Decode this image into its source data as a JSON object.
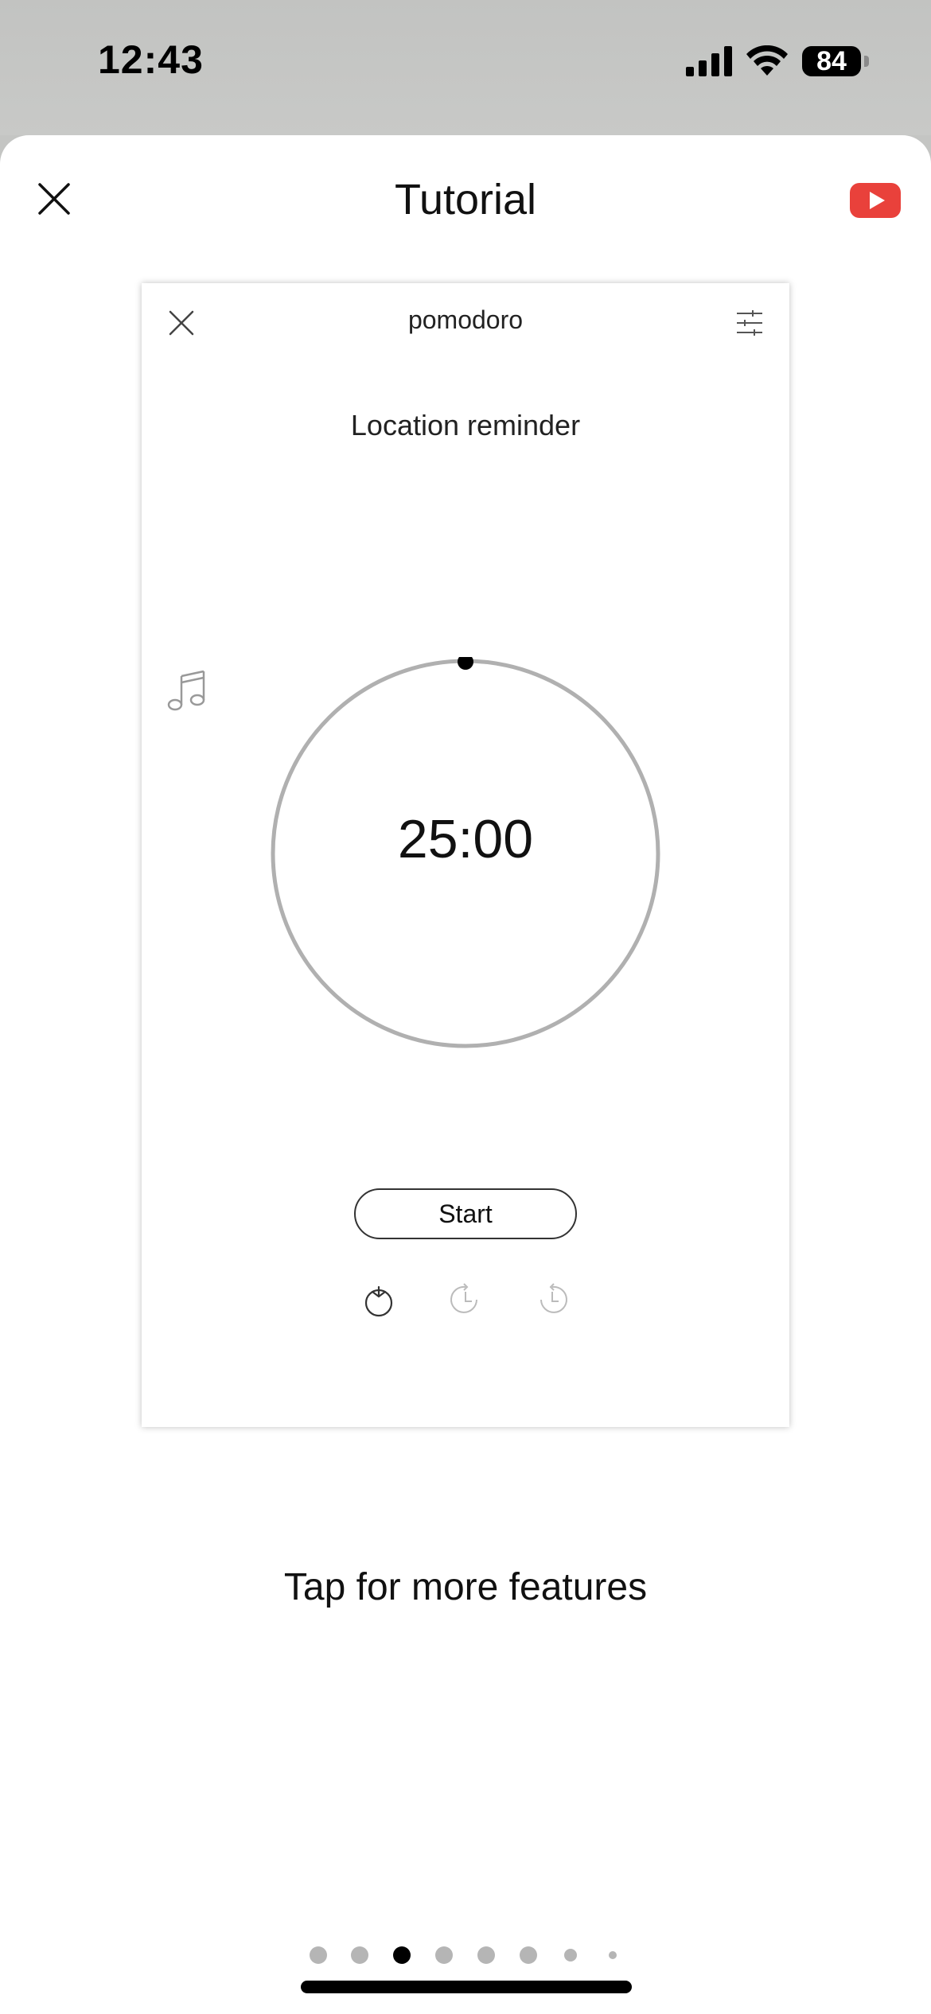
{
  "status_bar": {
    "time": "12:43",
    "battery": "84"
  },
  "sheet": {
    "title": "Tutorial",
    "close_icon": "close-icon",
    "video_icon": "youtube-play-icon",
    "video_color": "#e9413b"
  },
  "preview": {
    "title": "pomodoro",
    "subtitle": "Location reminder",
    "timer": "25:00",
    "start_label": "Start",
    "icons": {
      "close": "close-icon",
      "settings": "sliders-icon",
      "music": "music-note-icon",
      "tabs": [
        "tomato-icon",
        "clock-forward-icon",
        "clock-back-icon"
      ]
    }
  },
  "caption": "Tap for more features",
  "pagination": {
    "total": 8,
    "active_index": 2
  }
}
